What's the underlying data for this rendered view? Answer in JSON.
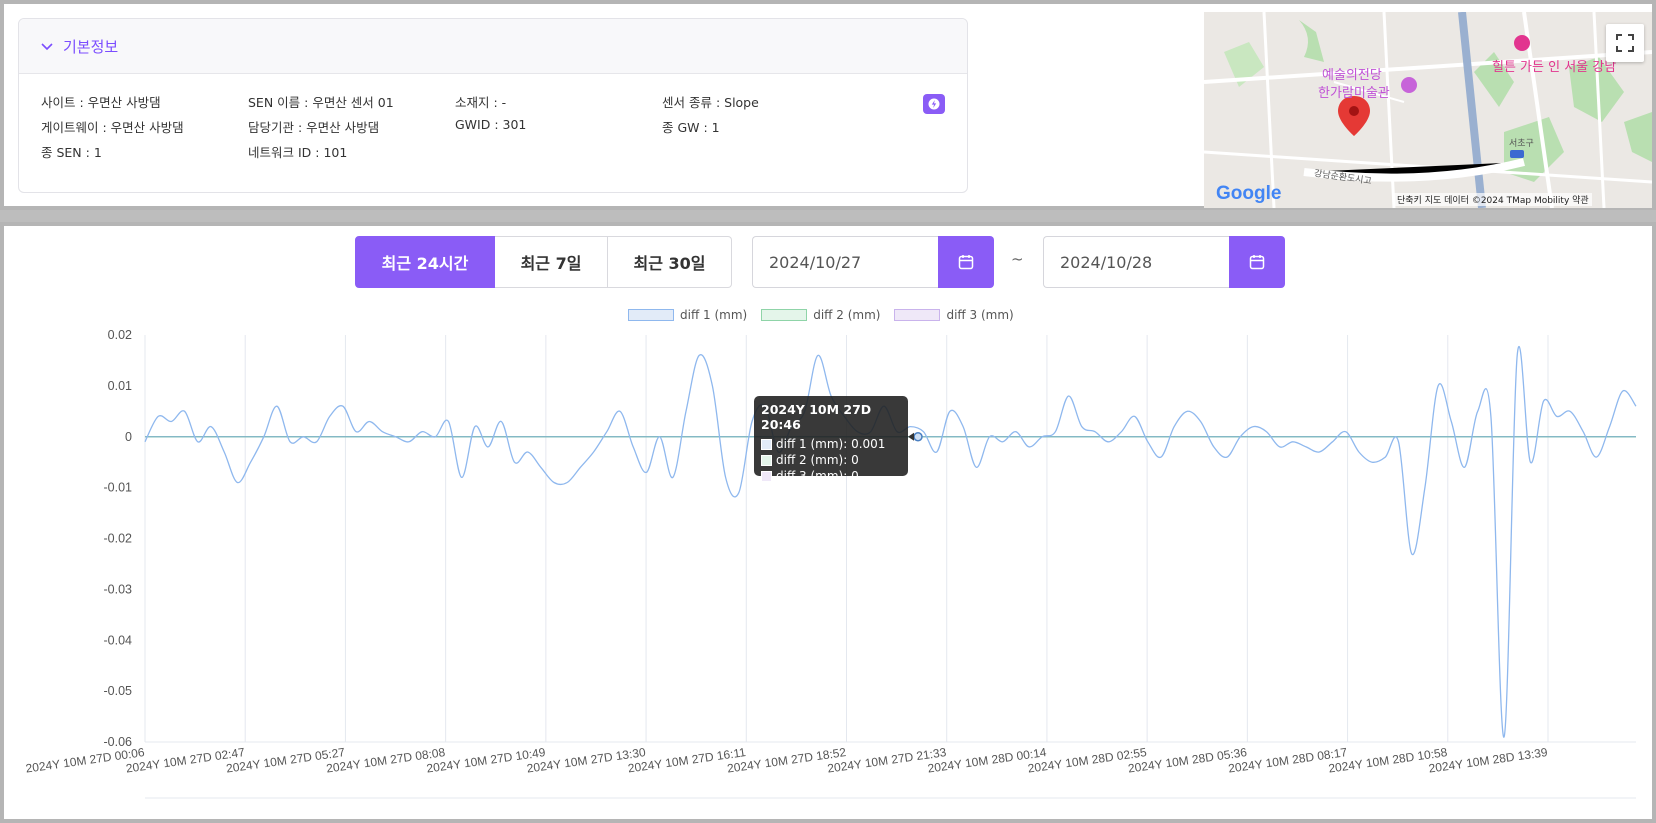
{
  "info": {
    "title": "기본정보",
    "fields": [
      {
        "text": "사이트 : 우면산 사방댐"
      },
      {
        "text": "SEN 이름 : 우면산 센서 01"
      },
      {
        "text": "소재지 : -"
      },
      {
        "text": "센서 종류 : Slope"
      },
      {
        "text": "게이트웨이 : 우면산 사방댐"
      },
      {
        "text": "담당기관 : 우면산 사방댐"
      },
      {
        "text": "GWID : 301"
      },
      {
        "text": "종 GW : 1"
      },
      {
        "text": "종 SEN : 1"
      },
      {
        "text": "네트워크 ID : 101"
      }
    ]
  },
  "map": {
    "labels": {
      "arts": "예술의전당",
      "museum": "한가람미술관",
      "hotel": "힐튼 가든 인 서울 강남",
      "road": "강남순환도시고",
      "seocho": "서초구"
    },
    "footer": "단축키   지도 데이터 ©2024 TMap Mobility   약관",
    "logo": "Google"
  },
  "range_buttons": [
    "최근 24시간",
    "최근 7일",
    "최근 30일"
  ],
  "date_from": "2024/10/27",
  "date_to": "2024/10/28",
  "tilde": "~",
  "tooltip": {
    "title": "2024Y 10M 27D 20:46",
    "rows": [
      "diff 1 (mm): 0.001",
      "diff 2 (mm): 0",
      "diff 3 (mm): 0"
    ]
  },
  "colors": {
    "accent": "#8a5cf6",
    "series1": "#8fb8ee",
    "series2": "#8fd4a8",
    "series3": "#c9b3ec"
  },
  "chart_data": {
    "type": "line",
    "title": "",
    "legend_position": "top",
    "grid": true,
    "series": [
      {
        "name": "diff 1 (mm)",
        "color": "#8fb8ee"
      },
      {
        "name": "diff 2 (mm)",
        "color": "#8fd4a8"
      },
      {
        "name": "diff 3 (mm)",
        "color": "#c9b3ec"
      }
    ],
    "ylim": [
      -0.06,
      0.02
    ],
    "yticks": [
      "0.02",
      "0.01",
      "0",
      "-0.01",
      "-0.02",
      "-0.03",
      "-0.04",
      "-0.05",
      "-0.06"
    ],
    "ytick_values": [
      0.02,
      0.01,
      0,
      -0.01,
      -0.02,
      -0.03,
      -0.04,
      -0.05,
      -0.06
    ],
    "xticks": [
      "2024Y 10M 27D 00:06",
      "2024Y 10M 27D 02:47",
      "2024Y 10M 27D 05:27",
      "2024Y 10M 27D 08:08",
      "2024Y 10M 27D 10:49",
      "2024Y 10M 27D 13:30",
      "2024Y 10M 27D 16:11",
      "2024Y 10M 27D 18:52",
      "2024Y 10M 27D 21:33",
      "2024Y 10M 28D 00:14",
      "2024Y 10M 28D 02:55",
      "2024Y 10M 28D 05:36",
      "2024Y 10M 28D 08:17",
      "2024Y 10M 28D 10:58",
      "2024Y 10M 28D 13:39"
    ],
    "diff1_values": [
      -0.001,
      0.004,
      0.003,
      0.005,
      -0.001,
      0.002,
      -0.003,
      -0.009,
      -0.005,
      0.0,
      0.006,
      -0.001,
      0.0,
      -0.001,
      0.004,
      0.006,
      0.001,
      0.003,
      0.001,
      0.0,
      -0.001,
      0.001,
      0.0,
      0.003,
      -0.008,
      0.002,
      -0.002,
      0.003,
      -0.005,
      -0.003,
      -0.006,
      -0.009,
      -0.009,
      -0.006,
      -0.003,
      0.001,
      0.005,
      -0.002,
      -0.007,
      0.0,
      -0.008,
      0.005,
      0.016,
      0.01,
      -0.008,
      -0.011,
      0.003,
      0.006,
      -0.003,
      0.002,
      0.005,
      0.016,
      0.008,
      0.004,
      0.001,
      0.001,
      0.006,
      0.001,
      0.002,
      0.001,
      -0.003,
      0.005,
      0.002,
      -0.006,
      0.0,
      -0.001,
      0.001,
      -0.002,
      0.0,
      0.001,
      0.008,
      0.002,
      0.001,
      -0.001,
      0.001,
      0.004,
      -0.001,
      -0.004,
      0.002,
      0.005,
      0.003,
      -0.002,
      -0.004,
      0.0,
      0.002,
      0.001,
      -0.002,
      -0.001,
      -0.002,
      -0.003,
      -0.001,
      0.001,
      -0.003,
      -0.005,
      -0.004,
      -0.001,
      -0.023,
      -0.01,
      0.01,
      0.003,
      -0.006,
      0.005,
      0.004,
      -0.059,
      0.016,
      -0.005,
      0.007,
      0.004,
      0.005,
      0.001,
      -0.004,
      0.002,
      0.009,
      0.006
    ],
    "diff2_values": "all 0",
    "diff3_values": "all 0"
  }
}
